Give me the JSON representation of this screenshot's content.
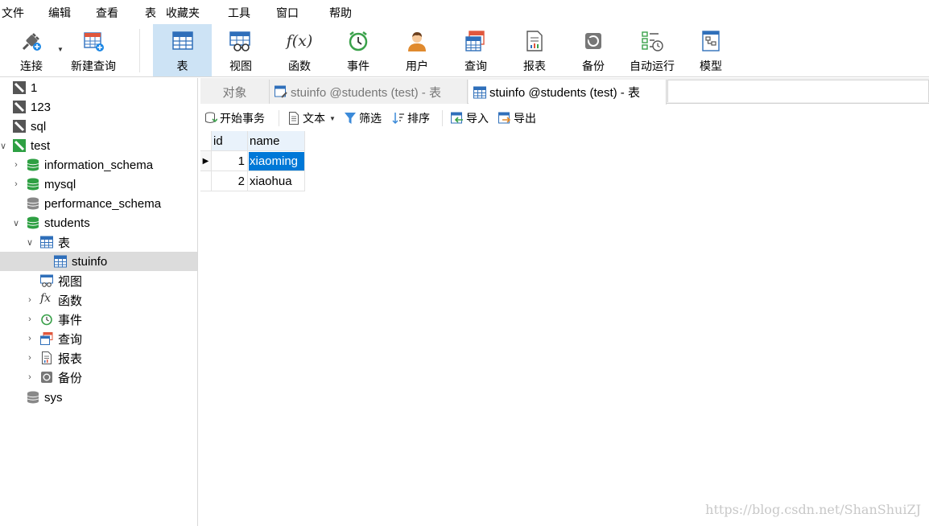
{
  "menu": {
    "file": "文件",
    "edit": "编辑",
    "view": "查看",
    "table": "表",
    "favorites": "收藏夹",
    "tools": "工具",
    "window": "窗口",
    "help": "帮助"
  },
  "toolbar": {
    "connect": "连接",
    "new_query": "新建查询",
    "table": "表",
    "view": "视图",
    "function": "函数",
    "event": "事件",
    "user": "用户",
    "query": "查询",
    "report": "报表",
    "backup": "备份",
    "automation": "自动运行",
    "model": "模型",
    "function_icon_text": "f(x)"
  },
  "sidebar": {
    "conn_1": "1",
    "conn_123": "123",
    "conn_sql": "sql",
    "conn_test": "test",
    "db_information_schema": "information_schema",
    "db_mysql": "mysql",
    "db_performance_schema": "performance_schema",
    "db_students": "students",
    "node_tables": "表",
    "table_stuinfo": "stuinfo",
    "node_views": "视图",
    "node_functions": "函数",
    "node_events": "事件",
    "node_queries": "查询",
    "node_reports": "报表",
    "node_backups": "备份",
    "db_sys": "sys",
    "fx_glyph": "fx"
  },
  "tabs": {
    "objects": "对象",
    "tab1": "stuinfo @students (test) - 表",
    "tab2": "stuinfo @students (test) - 表"
  },
  "subtoolbar": {
    "begin_transaction": "开始事务",
    "text": "文本",
    "filter": "筛选",
    "sort": "排序",
    "import": "导入",
    "export": "导出"
  },
  "grid": {
    "columns": [
      "id",
      "name"
    ],
    "rows": [
      {
        "id": "1",
        "name": "xiaoming"
      },
      {
        "id": "2",
        "name": "xiaohua"
      }
    ]
  },
  "watermark": "https://blog.csdn.net/ShanShuiZJ",
  "colors": {
    "accent": "#0078d7",
    "active_tool": "#cde3f5",
    "db_green": "#2ea043",
    "selected_row": "#dcdcdc"
  }
}
